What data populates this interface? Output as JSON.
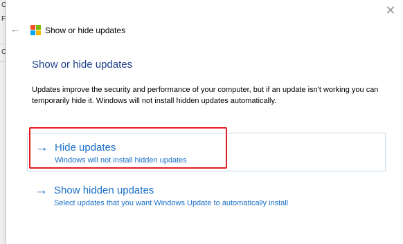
{
  "background": {
    "fragments": [
      "C",
      "F",
      "C"
    ]
  },
  "dialog": {
    "window_title": "Show or hide updates",
    "heading": "Show or hide updates",
    "description": "Updates improve the security and performance of your computer, but if an update isn't working you can temporarily hide it. Windows will not install hidden updates automatically.",
    "options": [
      {
        "title": "Hide updates",
        "subtitle": "Windows will not install hidden updates",
        "highlighted": true
      },
      {
        "title": "Show hidden updates",
        "subtitle": "Select updates that you want Windows Update to automatically install",
        "highlighted": false
      }
    ]
  },
  "icons": {
    "close": "close-icon",
    "back": "back-arrow-icon",
    "app": "windows-logo-icon",
    "option_arrow": "right-arrow-icon"
  },
  "colors": {
    "link_blue": "#1a6fc7",
    "heading_blue": "#1e3f8b",
    "highlight_red": "#e11b22",
    "hover_border": "#c5dcec",
    "logo_red": "#f25022",
    "logo_green": "#7fba00",
    "logo_blue": "#00a4ef",
    "logo_yellow": "#ffb900"
  }
}
